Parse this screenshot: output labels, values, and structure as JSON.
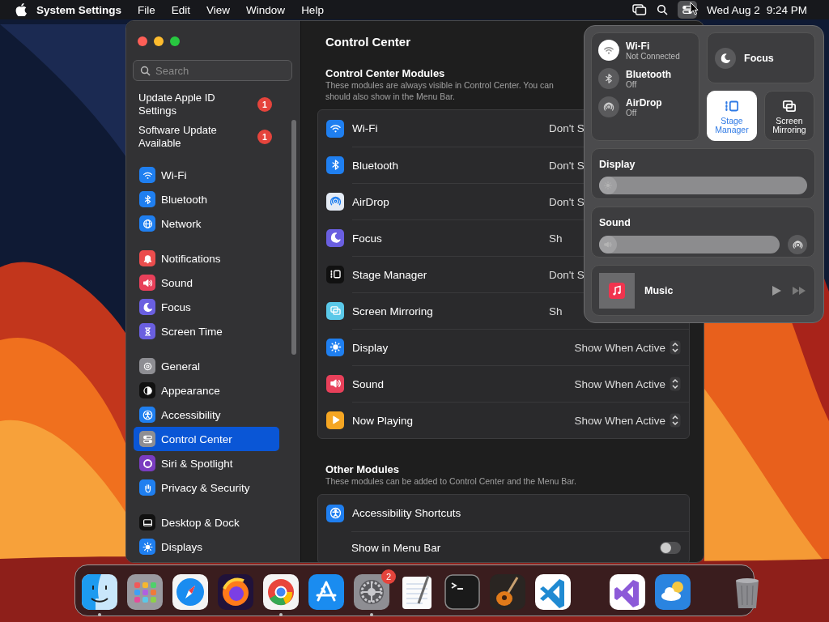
{
  "menu_bar": {
    "app_name": "System Settings",
    "menus": [
      "File",
      "Edit",
      "View",
      "Window",
      "Help"
    ],
    "control_center_open": true,
    "date": "Wed Aug 2",
    "time": "9:24 PM"
  },
  "sidebar": {
    "search": {
      "placeholder": "Search"
    },
    "groups": [
      [
        {
          "kind": "alert",
          "label": "Update Apple ID Settings",
          "badge": "1",
          "selected": false
        },
        {
          "kind": "alert",
          "label": "Software Update Available",
          "badge": "1",
          "selected": false
        }
      ],
      [
        {
          "kind": "pane",
          "label": "Wi-Fi",
          "color": "#1f7ff0",
          "selected": false
        },
        {
          "kind": "pane",
          "label": "Bluetooth",
          "color": "#1f7ff0",
          "selected": false
        },
        {
          "kind": "pane",
          "label": "Network",
          "color": "#1f7ff0",
          "selected": false
        }
      ],
      [
        {
          "kind": "pane",
          "label": "Notifications",
          "color": "#eb4d4d",
          "selected": false
        },
        {
          "kind": "pane",
          "label": "Sound",
          "color": "#e8405a",
          "selected": false
        },
        {
          "kind": "pane",
          "label": "Focus",
          "color": "#6a5fe0",
          "selected": false
        },
        {
          "kind": "pane",
          "label": "Screen Time",
          "color": "#6a5fe0",
          "selected": false
        }
      ],
      [
        {
          "kind": "pane",
          "label": "General",
          "color": "#8e8e93",
          "selected": false
        },
        {
          "kind": "pane",
          "label": "Appearance",
          "color": "#111111",
          "selected": false
        },
        {
          "kind": "pane",
          "label": "Accessibility",
          "color": "#1f7ff0",
          "selected": false
        },
        {
          "kind": "pane",
          "label": "Control Center",
          "color": "#8e8e93",
          "selected": true
        },
        {
          "kind": "pane",
          "label": "Siri & Spotlight",
          "color": "#7a3cc0",
          "selected": false
        },
        {
          "kind": "pane",
          "label": "Privacy & Security",
          "color": "#1f7ff0",
          "selected": false
        }
      ],
      [
        {
          "kind": "pane",
          "label": "Desktop & Dock",
          "color": "#111111",
          "selected": false
        },
        {
          "kind": "pane",
          "label": "Displays",
          "color": "#1f7ff0",
          "selected": false
        }
      ]
    ]
  },
  "content": {
    "title": "Control Center",
    "sections": [
      {
        "heading": "Control Center Modules",
        "description": [
          "These modules are always visible in Control Center. You can",
          "should also show in the Menu Bar."
        ],
        "rows": [
          {
            "kind": "choice",
            "label": "Wi-Fi",
            "color": "#1f7ff0",
            "value": "Don't S",
            "stepper": false
          },
          {
            "kind": "choice",
            "label": "Bluetooth",
            "color": "#1f7ff0",
            "value": "Don't S",
            "stepper": false
          },
          {
            "kind": "choice",
            "label": "AirDrop",
            "color": "#e4ebf5",
            "value": "Don't S",
            "stepper": false
          },
          {
            "kind": "choice",
            "label": "Focus",
            "color": "#6a5fe0",
            "value": "Sh",
            "stepper": false
          },
          {
            "kind": "choice",
            "label": "Stage Manager",
            "color": "#111111",
            "value": "Don't S",
            "stepper": false
          },
          {
            "kind": "choice",
            "label": "Screen Mirroring",
            "color": "#5ac8e8",
            "value": "Sh",
            "stepper": false
          },
          {
            "kind": "choice",
            "label": "Display",
            "color": "#1f7ff0",
            "value": "Show When Active",
            "stepper": true
          },
          {
            "kind": "choice",
            "label": "Sound",
            "color": "#e8405a",
            "value": "Show When Active",
            "stepper": true
          },
          {
            "kind": "choice",
            "label": "Now Playing",
            "color": "#f5a623",
            "value": "Show When Active",
            "stepper": true
          }
        ]
      },
      {
        "heading": "Other Modules",
        "description": [
          "These modules can be added to Control Center and the Menu Bar."
        ],
        "rows": [
          {
            "kind": "module",
            "label": "Accessibility Shortcuts",
            "color": "#1f7ff0"
          },
          {
            "kind": "toggle",
            "label": "Show in Menu Bar",
            "on": false
          }
        ]
      }
    ]
  },
  "control_center": {
    "network": [
      {
        "label": "Wi-Fi",
        "status": "Not Connected",
        "on": true
      },
      {
        "label": "Bluetooth",
        "status": "Off",
        "on": false
      },
      {
        "label": "AirDrop",
        "status": "Off",
        "on": false
      }
    ],
    "focus": {
      "label": "Focus",
      "on": false
    },
    "tiles": [
      {
        "label": "Stage Manager",
        "on": true
      },
      {
        "label": "Screen Mirroring",
        "on": false
      }
    ],
    "sliders": [
      {
        "label": "Display",
        "level": 0,
        "airplay": false
      },
      {
        "label": "Sound",
        "level": 0,
        "airplay": true
      }
    ],
    "now_playing": {
      "app": "Music"
    }
  },
  "dock": {
    "groups": [
      [
        {
          "running": true
        },
        {
          "running": false
        },
        {
          "running": false
        },
        {
          "running": false
        },
        {
          "running": true
        },
        {
          "running": false
        },
        {
          "running": true,
          "badge": "2"
        },
        {
          "running": false
        },
        {
          "running": false
        },
        {
          "running": false
        },
        {
          "running": false
        }
      ],
      [
        {
          "running": false
        },
        {
          "running": false
        }
      ],
      [
        {
          "running": false
        }
      ]
    ]
  }
}
